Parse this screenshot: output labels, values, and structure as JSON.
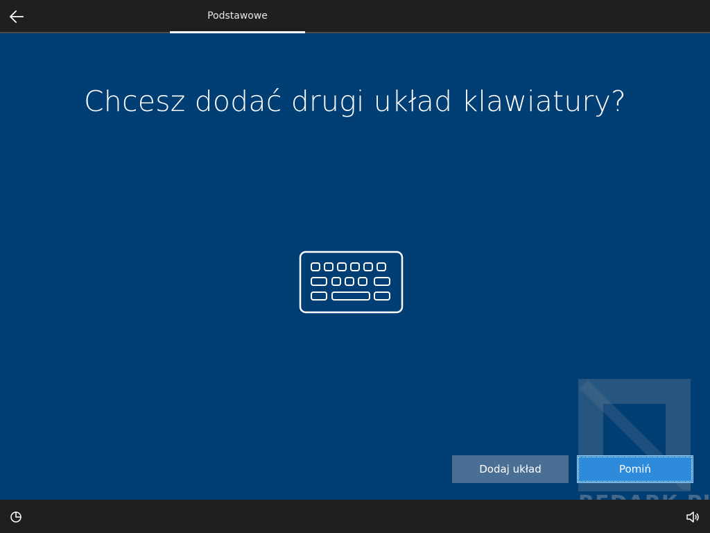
{
  "header": {
    "back_icon": "arrow-left-icon",
    "tab_label": "Podstawowe"
  },
  "main": {
    "heading": "Chcesz dodać drugi układ klawiatury?",
    "illustration_icon": "keyboard-icon"
  },
  "actions": {
    "add_layout_label": "Dodaj układ",
    "skip_label": "Pomiń"
  },
  "watermark": {
    "text": "REDARK.PL"
  },
  "footer": {
    "left_icon": "ease-of-access-icon",
    "right_icon": "volume-icon"
  },
  "colors": {
    "background": "#003e74",
    "bar": "#1f1f1f",
    "primary_button": "#2e8adb",
    "secondary_button": "#4a6f95"
  }
}
